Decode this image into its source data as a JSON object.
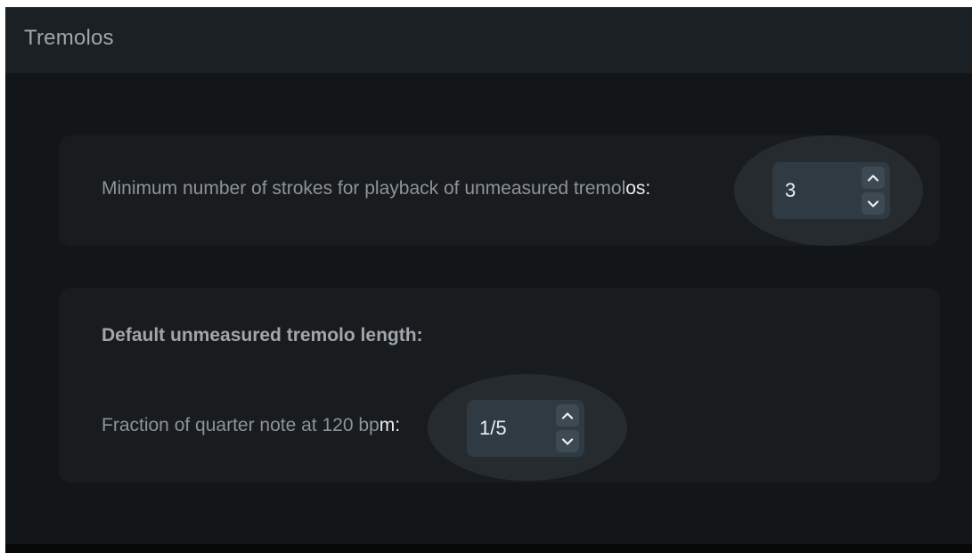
{
  "header": {
    "title": "Tremolos"
  },
  "strokes": {
    "label_main": "Minimum number of strokes for playback of unmeasured tremol",
    "label_tail": "os:",
    "value": "3"
  },
  "length": {
    "section_title": "Default unmeasured tremolo length:",
    "label_main": "Fraction of quarter note at 120 bp",
    "label_tail": "m:",
    "value": "1/5"
  },
  "icons": {
    "increment": "chevron-up-icon",
    "decrement": "chevron-down-icon"
  },
  "colors": {
    "panel_background": "#121619",
    "header_background": "#1b2024",
    "card_background": "#181c1f",
    "spin_box": "#2f3a42",
    "focus_highlight": "#262b2f"
  }
}
